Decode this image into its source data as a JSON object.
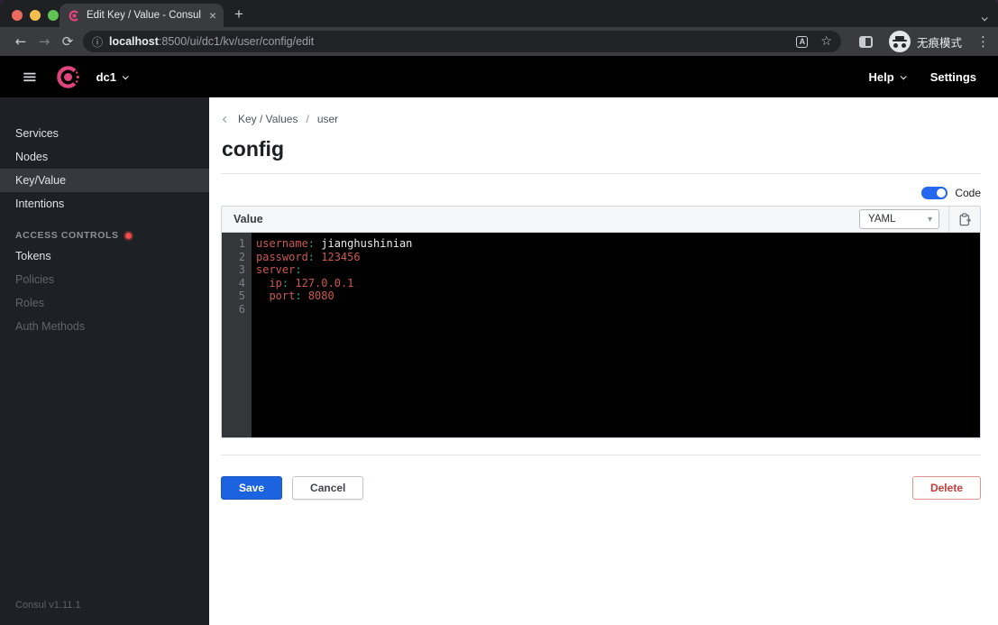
{
  "colors": {
    "consul_pink": "#e0447c",
    "save_blue": "#1c63e0",
    "toggle_blue": "#2468ef",
    "delete_red": "#c43d3a",
    "code_key_red": "#cc5850",
    "code_colon_green": "#2eaa7e",
    "code_string_white": "#ececec",
    "editor_bg": "#000000"
  },
  "browser": {
    "tab": {
      "title": "Edit Key / Value - Consul",
      "close_icon": "×"
    },
    "new_tab_icon": "+",
    "toolbar": {
      "back_icon": "←",
      "forward_icon": "→",
      "reload_icon": "⟳",
      "info_icon": "ⓘ",
      "url_host": "localhost",
      "url_rest": ":8500/ui/dc1/kv/user/config/edit",
      "translate_icon_letter": "A",
      "star_icon": "☆",
      "incognito_label": "无痕模式",
      "menu_icon": "⋮"
    }
  },
  "appnav": {
    "menu_icon": "≡",
    "datacenter": "dc1",
    "help_label": "Help",
    "settings_label": "Settings"
  },
  "sidebar": {
    "items": [
      {
        "label": "Services",
        "state": "normal"
      },
      {
        "label": "Nodes",
        "state": "normal"
      },
      {
        "label": "Key/Value",
        "state": "active"
      },
      {
        "label": "Intentions",
        "state": "normal"
      }
    ],
    "acl": {
      "section": "ACCESS CONTROLS",
      "items": [
        {
          "label": "Tokens",
          "state": "normal"
        },
        {
          "label": "Policies",
          "state": "disabled"
        },
        {
          "label": "Roles",
          "state": "disabled"
        },
        {
          "label": "Auth Methods",
          "state": "disabled"
        }
      ]
    },
    "version": "Consul v1.11.1"
  },
  "main": {
    "breadcrumb": {
      "link": "Key / Values",
      "separator": "/",
      "current": "user"
    },
    "title": "config",
    "code_toggle": {
      "label": "Code",
      "on": true
    },
    "panel": {
      "header": "Value",
      "format": "YAML",
      "select_caret": "▾"
    },
    "editor": {
      "lines": [
        {
          "no": "1",
          "tokens": [
            {
              "text": "username",
              "type": "key"
            },
            {
              "text": ":",
              "type": "punc"
            },
            {
              "text": " jianghushinian",
              "type": "str"
            }
          ]
        },
        {
          "no": "2",
          "tokens": [
            {
              "text": "password",
              "type": "key"
            },
            {
              "text": ":",
              "type": "punc"
            },
            {
              "text": " 123456",
              "type": "num"
            }
          ]
        },
        {
          "no": "3",
          "tokens": [
            {
              "text": "server",
              "type": "key"
            },
            {
              "text": ":",
              "type": "punc"
            }
          ]
        },
        {
          "no": "4",
          "tokens": [
            {
              "text": "  ip",
              "type": "key"
            },
            {
              "text": ":",
              "type": "punc"
            },
            {
              "text": " 127.0.0.1",
              "type": "num"
            }
          ]
        },
        {
          "no": "5",
          "tokens": [
            {
              "text": "  port",
              "type": "key"
            },
            {
              "text": ":",
              "type": "punc"
            },
            {
              "text": " 8080",
              "type": "num"
            }
          ]
        },
        {
          "no": "6",
          "tokens": []
        }
      ]
    },
    "actions": {
      "save": "Save",
      "cancel": "Cancel",
      "delete": "Delete"
    }
  }
}
